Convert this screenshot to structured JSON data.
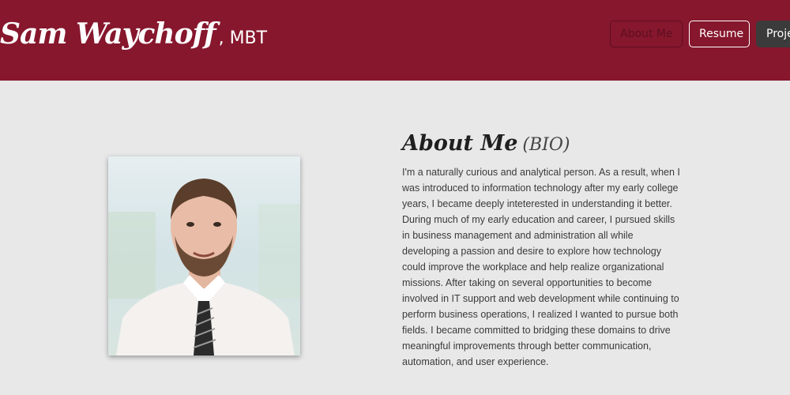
{
  "header": {
    "brand_name": "Sam Waychoff",
    "brand_suffix": ", MBT",
    "background_color": "#86172d"
  },
  "nav": {
    "about": "About Me",
    "resume": "Resume",
    "projects": "Proje"
  },
  "about": {
    "title": "About Me",
    "subtitle": "(BIO)",
    "bio": "I'm a naturally curious and analytical person. As a result, when I was introduced to information technology after my early college years, I became deeply inteterested in understanding it better. During much of my early education and career, I pursued skills in business management and administration all while developing a passion and desire to explore how technology could improve the workplace and help realize organizational missions. After taking on several opportunities to become involved in IT support and web development while continuing to perform business operations, I realized I wanted to pursue both fields. I became committed to bridging these domains to drive meaningful improvements through better communication, automation, and user experience."
  }
}
